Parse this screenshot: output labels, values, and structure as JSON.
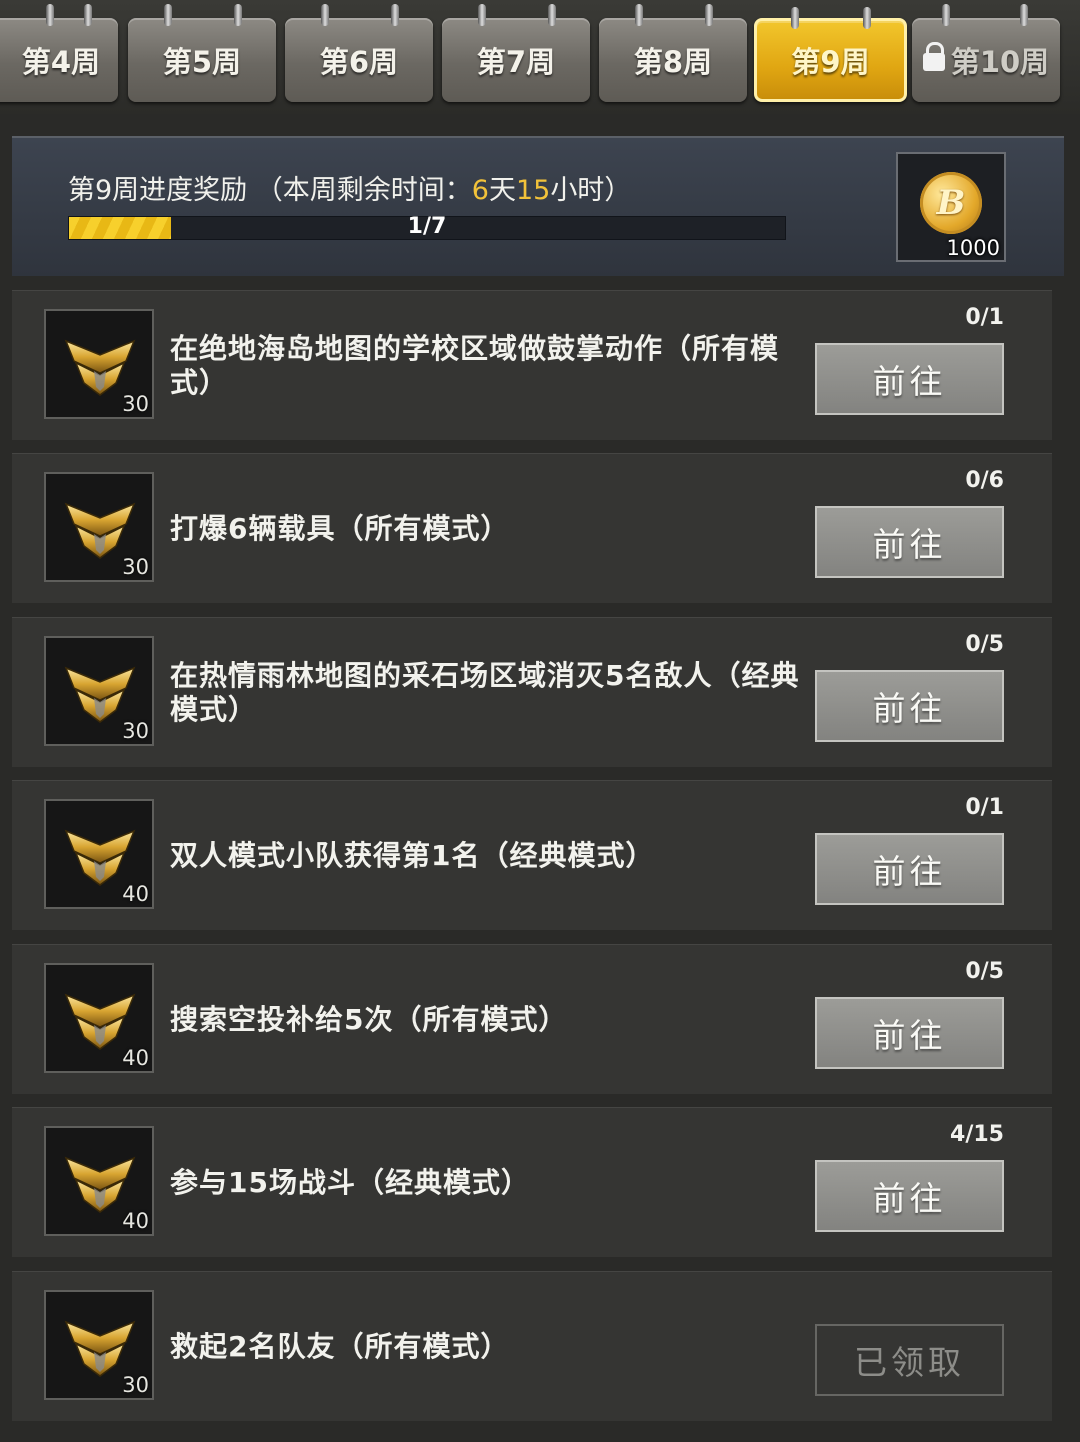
{
  "tabs": [
    {
      "label": "第4周",
      "state": "normal"
    },
    {
      "label": "第5周",
      "state": "normal"
    },
    {
      "label": "第6周",
      "state": "normal"
    },
    {
      "label": "第7周",
      "state": "normal"
    },
    {
      "label": "第8周",
      "state": "normal"
    },
    {
      "label": "第9周",
      "state": "active"
    },
    {
      "label": "第10周",
      "state": "locked"
    }
  ],
  "progress": {
    "title_prefix": "第9周进度奖励 （本周剩余时间：",
    "time_days": "6",
    "time_days_unit": "天",
    "time_hours": "15",
    "time_hours_unit": "小时",
    "title_suffix": "）",
    "bar_text": "1/7",
    "fraction": 0.143,
    "reward_count": "1000",
    "reward_icon": "coin-icon"
  },
  "tasks": [
    {
      "points": "30",
      "desc": "在绝地海岛地图的学校区域做鼓掌动作（所有模式）",
      "count": "0/1",
      "button": "前往",
      "done": false
    },
    {
      "points": "30",
      "desc": "打爆6辆载具（所有模式）",
      "count": "0/6",
      "button": "前往",
      "done": false
    },
    {
      "points": "30",
      "desc": "在热情雨林地图的采石场区域消灭5名敌人（经典模式）",
      "count": "0/5",
      "button": "前往",
      "done": false
    },
    {
      "points": "40",
      "desc": "双人模式小队获得第1名（经典模式）",
      "count": "0/1",
      "button": "前往",
      "done": false
    },
    {
      "points": "40",
      "desc": "搜索空投补给5次（所有模式）",
      "count": "0/5",
      "button": "前往",
      "done": false
    },
    {
      "points": "40",
      "desc": "参与15场战斗（经典模式）",
      "count": "4/15",
      "button": "前往",
      "done": false
    },
    {
      "points": "30",
      "desc": "救起2名队友（所有模式）",
      "count": "",
      "button": "已领取",
      "done": true
    }
  ],
  "colors": {
    "accent": "#f2c23a",
    "active_tab": "#e0a612",
    "button": "#8f8f8c"
  }
}
